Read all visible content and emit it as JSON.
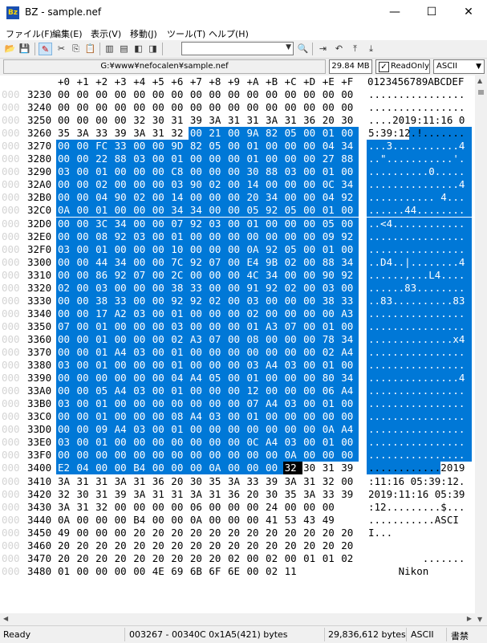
{
  "window": {
    "app_icon_text": "Bz",
    "title": "BZ - sample.nef",
    "minimize": "—",
    "maximize": "☐",
    "close": "✕"
  },
  "menu": [
    {
      "label": "ファイル(F)"
    },
    {
      "label": "編集(E)"
    },
    {
      "label": "表示(V)"
    },
    {
      "label": "移動(J)"
    },
    {
      "label": "ツール(T)"
    },
    {
      "label": "ヘルプ(H)"
    }
  ],
  "toolbar": {
    "buttons": [
      {
        "name": "open-icon",
        "glyph": "📂"
      },
      {
        "name": "save-icon",
        "glyph": "💾"
      },
      {
        "name": "readonly-toggle-icon",
        "glyph": "✎"
      },
      {
        "name": "cut-icon",
        "glyph": "✂"
      },
      {
        "name": "copy-icon",
        "glyph": "⎘"
      },
      {
        "name": "paste-icon",
        "glyph": "📋"
      },
      {
        "name": "view-single-icon",
        "glyph": "▥"
      },
      {
        "name": "view-split-icon",
        "glyph": "▤"
      },
      {
        "name": "view-left-icon",
        "glyph": "◧"
      },
      {
        "name": "view-right-icon",
        "glyph": "◨"
      },
      {
        "name": "find-icon",
        "glyph": "🔍"
      },
      {
        "name": "jump-icon",
        "glyph": "⇥"
      },
      {
        "name": "back-icon",
        "glyph": "↶"
      },
      {
        "name": "top-icon",
        "glyph": "⤒"
      },
      {
        "name": "bottom-icon",
        "glyph": "⤓"
      }
    ],
    "combo_value": ""
  },
  "pathbar": {
    "path": "G:¥www¥nefocalen¥sample.nef",
    "size": "29.84 MB",
    "readonly_label": "ReadOnly",
    "readonly_checked": "✓",
    "encoding": "ASCII"
  },
  "hex": {
    "header_cols": [
      "+0",
      "+1",
      "+2",
      "+3",
      "+4",
      "+5",
      "+6",
      "+7",
      "+8",
      "+9",
      "+A",
      "+B",
      "+C",
      "+D",
      "+E",
      "+F"
    ],
    "header_ascii": "0123456789ABCDEF",
    "rows": [
      {
        "pre": "000",
        "addr": "3230",
        "b": [
          "00",
          "00",
          "00",
          "00",
          "00",
          "00",
          "00",
          "00",
          "00",
          "00",
          "00",
          "00",
          "00",
          "00",
          "00",
          "00"
        ],
        "ascii": "................"
      },
      {
        "pre": "000",
        "addr": "3240",
        "b": [
          "00",
          "00",
          "00",
          "00",
          "00",
          "00",
          "00",
          "00",
          "00",
          "00",
          "00",
          "00",
          "00",
          "00",
          "00",
          "00"
        ],
        "ascii": "................"
      },
      {
        "pre": "000",
        "addr": "3250",
        "b": [
          "00",
          "00",
          "00",
          "00",
          "32",
          "30",
          "31",
          "39",
          "3A",
          "31",
          "31",
          "3A",
          "31",
          "36",
          "20",
          "30"
        ],
        "ascii": "....2019:11:16 0"
      },
      {
        "pre": "000",
        "addr": "3260",
        "b": [
          "35",
          "3A",
          "33",
          "39",
          "3A",
          "31",
          "32",
          "00",
          "21",
          "00",
          "9A",
          "82",
          "05",
          "00",
          "01",
          "00"
        ],
        "ascii": "5:39:12.!......."
      },
      {
        "pre": "000",
        "addr": "3270",
        "b": [
          "00",
          "00",
          "FC",
          "33",
          "00",
          "00",
          "9D",
          "82",
          "05",
          "00",
          "01",
          "00",
          "00",
          "00",
          "04",
          "34"
        ],
        "ascii": "...3...........4"
      },
      {
        "pre": "000",
        "addr": "3280",
        "b": [
          "00",
          "00",
          "22",
          "88",
          "03",
          "00",
          "01",
          "00",
          "00",
          "00",
          "01",
          "00",
          "00",
          "00",
          "27",
          "88"
        ],
        "ascii": "..\"...........'."
      },
      {
        "pre": "000",
        "addr": "3290",
        "b": [
          "03",
          "00",
          "01",
          "00",
          "00",
          "00",
          "C8",
          "00",
          "00",
          "00",
          "30",
          "88",
          "03",
          "00",
          "01",
          "00"
        ],
        "ascii": "..........0....."
      },
      {
        "pre": "000",
        "addr": "32A0",
        "b": [
          "00",
          "00",
          "02",
          "00",
          "00",
          "00",
          "03",
          "90",
          "02",
          "00",
          "14",
          "00",
          "00",
          "00",
          "0C",
          "34"
        ],
        "ascii": "...............4"
      },
      {
        "pre": "000",
        "addr": "32B0",
        "b": [
          "00",
          "00",
          "04",
          "90",
          "02",
          "00",
          "14",
          "00",
          "00",
          "00",
          "20",
          "34",
          "00",
          "00",
          "04",
          "92"
        ],
        "ascii": "........... 4..."
      },
      {
        "pre": "000",
        "addr": "32C0",
        "b": [
          "0A",
          "00",
          "01",
          "00",
          "00",
          "00",
          "34",
          "34",
          "00",
          "00",
          "05",
          "92",
          "05",
          "00",
          "01",
          "00"
        ],
        "ascii": "......44........"
      },
      {
        "pre": "000",
        "addr": "32D0",
        "b": [
          "00",
          "00",
          "3C",
          "34",
          "00",
          "00",
          "07",
          "92",
          "03",
          "00",
          "01",
          "00",
          "00",
          "00",
          "05",
          "00"
        ],
        "ascii": "..<4............"
      },
      {
        "pre": "000",
        "addr": "32E0",
        "b": [
          "00",
          "00",
          "08",
          "92",
          "03",
          "00",
          "01",
          "00",
          "00",
          "00",
          "00",
          "00",
          "00",
          "00",
          "09",
          "92"
        ],
        "ascii": "................"
      },
      {
        "pre": "000",
        "addr": "32F0",
        "b": [
          "03",
          "00",
          "01",
          "00",
          "00",
          "00",
          "10",
          "00",
          "00",
          "00",
          "0A",
          "92",
          "05",
          "00",
          "01",
          "00"
        ],
        "ascii": "................"
      },
      {
        "pre": "000",
        "addr": "3300",
        "b": [
          "00",
          "00",
          "44",
          "34",
          "00",
          "00",
          "7C",
          "92",
          "07",
          "00",
          "E4",
          "9B",
          "02",
          "00",
          "88",
          "34"
        ],
        "ascii": "..D4..|........4"
      },
      {
        "pre": "000",
        "addr": "3310",
        "b": [
          "00",
          "00",
          "86",
          "92",
          "07",
          "00",
          "2C",
          "00",
          "00",
          "00",
          "4C",
          "34",
          "00",
          "00",
          "90",
          "92"
        ],
        "ascii": "......,...L4...."
      },
      {
        "pre": "000",
        "addr": "3320",
        "b": [
          "02",
          "00",
          "03",
          "00",
          "00",
          "00",
          "38",
          "33",
          "00",
          "00",
          "91",
          "92",
          "02",
          "00",
          "03",
          "00"
        ],
        "ascii": "......83........"
      },
      {
        "pre": "000",
        "addr": "3330",
        "b": [
          "00",
          "00",
          "38",
          "33",
          "00",
          "00",
          "92",
          "92",
          "02",
          "00",
          "03",
          "00",
          "00",
          "00",
          "38",
          "33"
        ],
        "ascii": "..83..........83"
      },
      {
        "pre": "000",
        "addr": "3340",
        "b": [
          "00",
          "00",
          "17",
          "A2",
          "03",
          "00",
          "01",
          "00",
          "00",
          "00",
          "02",
          "00",
          "00",
          "00",
          "00",
          "A3"
        ],
        "ascii": "................"
      },
      {
        "pre": "000",
        "addr": "3350",
        "b": [
          "07",
          "00",
          "01",
          "00",
          "00",
          "00",
          "03",
          "00",
          "00",
          "00",
          "01",
          "A3",
          "07",
          "00",
          "01",
          "00"
        ],
        "ascii": "................"
      },
      {
        "pre": "000",
        "addr": "3360",
        "b": [
          "00",
          "00",
          "01",
          "00",
          "00",
          "00",
          "02",
          "A3",
          "07",
          "00",
          "08",
          "00",
          "00",
          "00",
          "78",
          "34"
        ],
        "ascii": "..............x4"
      },
      {
        "pre": "000",
        "addr": "3370",
        "b": [
          "00",
          "00",
          "01",
          "A4",
          "03",
          "00",
          "01",
          "00",
          "00",
          "00",
          "00",
          "00",
          "00",
          "00",
          "02",
          "A4"
        ],
        "ascii": "................"
      },
      {
        "pre": "000",
        "addr": "3380",
        "b": [
          "03",
          "00",
          "01",
          "00",
          "00",
          "00",
          "01",
          "00",
          "00",
          "00",
          "03",
          "A4",
          "03",
          "00",
          "01",
          "00"
        ],
        "ascii": "................"
      },
      {
        "pre": "000",
        "addr": "3390",
        "b": [
          "00",
          "00",
          "00",
          "00",
          "00",
          "00",
          "04",
          "A4",
          "05",
          "00",
          "01",
          "00",
          "00",
          "00",
          "80",
          "34"
        ],
        "ascii": "...............4"
      },
      {
        "pre": "000",
        "addr": "33A0",
        "b": [
          "00",
          "00",
          "05",
          "A4",
          "03",
          "00",
          "01",
          "00",
          "00",
          "00",
          "12",
          "00",
          "00",
          "00",
          "06",
          "A4"
        ],
        "ascii": "................"
      },
      {
        "pre": "000",
        "addr": "33B0",
        "b": [
          "03",
          "00",
          "01",
          "00",
          "00",
          "00",
          "00",
          "00",
          "00",
          "00",
          "07",
          "A4",
          "03",
          "00",
          "01",
          "00"
        ],
        "ascii": "................"
      },
      {
        "pre": "000",
        "addr": "33C0",
        "b": [
          "00",
          "00",
          "01",
          "00",
          "00",
          "00",
          "08",
          "A4",
          "03",
          "00",
          "01",
          "00",
          "00",
          "00",
          "00",
          "00"
        ],
        "ascii": "................"
      },
      {
        "pre": "000",
        "addr": "33D0",
        "b": [
          "00",
          "00",
          "09",
          "A4",
          "03",
          "00",
          "01",
          "00",
          "00",
          "00",
          "00",
          "00",
          "00",
          "00",
          "0A",
          "A4"
        ],
        "ascii": "................"
      },
      {
        "pre": "000",
        "addr": "33E0",
        "b": [
          "03",
          "00",
          "01",
          "00",
          "00",
          "00",
          "00",
          "00",
          "00",
          "00",
          "0C",
          "A4",
          "03",
          "00",
          "01",
          "00"
        ],
        "ascii": "................"
      },
      {
        "pre": "000",
        "addr": "33F0",
        "b": [
          "00",
          "00",
          "00",
          "00",
          "00",
          "00",
          "00",
          "00",
          "00",
          "00",
          "00",
          "00",
          "0A",
          "00",
          "00",
          "00"
        ],
        "ascii": "................"
      },
      {
        "pre": "000",
        "addr": "3400",
        "b": [
          "E2",
          "04",
          "00",
          "00",
          "B4",
          "00",
          "00",
          "00",
          "0A",
          "00",
          "00",
          "00",
          "32",
          "30",
          "31",
          "39"
        ],
        "ascii": "............2019"
      },
      {
        "pre": "000",
        "addr": "3410",
        "b": [
          "3A",
          "31",
          "31",
          "3A",
          "31",
          "36",
          "20",
          "30",
          "35",
          "3A",
          "33",
          "39",
          "3A",
          "31",
          "32",
          "00"
        ],
        "ascii": ":11:16 05:39:12."
      },
      {
        "pre": "000",
        "addr": "3420",
        "b": [
          "32",
          "30",
          "31",
          "39",
          "3A",
          "31",
          "31",
          "3A",
          "31",
          "36",
          "20",
          "30",
          "35",
          "3A",
          "33",
          "39"
        ],
        "ascii": "2019:11:16 05:39"
      },
      {
        "pre": "000",
        "addr": "3430",
        "b": [
          "3A",
          "31",
          "32",
          "00",
          "00",
          "00",
          "00",
          "06",
          "00",
          "00",
          "00",
          "24",
          "00",
          "00",
          "00"
        ],
        "ascii": ":12.........$..."
      },
      {
        "pre": "000",
        "addr": "3440",
        "b": [
          "0A",
          "00",
          "00",
          "00",
          "B4",
          "00",
          "00",
          "0A",
          "00",
          "00",
          "00",
          "41",
          "53",
          "43",
          "49"
        ],
        "ascii": "...........ASCI"
      },
      {
        "pre": "000",
        "addr": "3450",
        "b": [
          "49",
          "00",
          "00",
          "00",
          "20",
          "20",
          "20",
          "20",
          "20",
          "20",
          "20",
          "20",
          "20",
          "20",
          "20",
          "20"
        ],
        "ascii": "I...            "
      },
      {
        "pre": "000",
        "addr": "3460",
        "b": [
          "20",
          "20",
          "20",
          "20",
          "20",
          "20",
          "20",
          "20",
          "20",
          "20",
          "20",
          "20",
          "20",
          "20",
          "20",
          "20"
        ],
        "ascii": "                "
      },
      {
        "pre": "000",
        "addr": "3470",
        "b": [
          "20",
          "20",
          "20",
          "20",
          "20",
          "20",
          "20",
          "20",
          "20",
          "02",
          "00",
          "02",
          "00",
          "01",
          "01",
          "02"
        ],
        "ascii": "         ......."
      },
      {
        "pre": "000",
        "addr": "3480",
        "b": [
          "01",
          "00",
          "00",
          "00",
          "00",
          "4E",
          "69",
          "6B",
          "6F",
          "6E",
          "00",
          "02",
          "11"
        ],
        "ascii": "     Nikon"
      }
    ]
  },
  "status": {
    "state": "Ready",
    "selection": "003267 - 00340C 0x1A5(421) bytes",
    "file_size": "29,836,612 bytes",
    "encoding": "ASCII",
    "mode": "書禁"
  }
}
